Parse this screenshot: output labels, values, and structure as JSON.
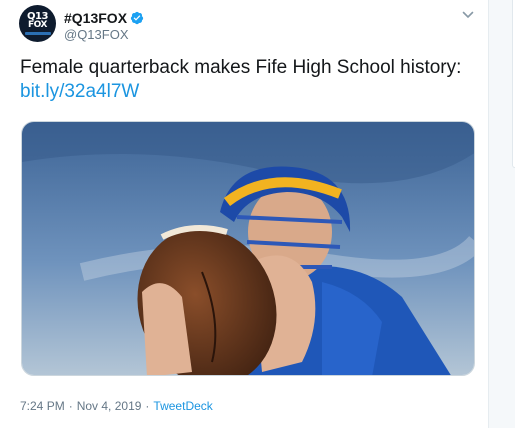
{
  "account": {
    "avatar_line1": "Q13",
    "avatar_line2": "FOX",
    "display_name": "#Q13FOX",
    "handle": "@Q13FOX"
  },
  "tweet": {
    "text": "Female quarterback makes Fife High School history:",
    "link": "bit.ly/32a4l7W",
    "time": "7:24 PM",
    "separator": "·",
    "date": "Nov 4, 2019",
    "separator2": "·",
    "source": "TweetDeck"
  },
  "colors": {
    "link": "#1b95e0",
    "verified": "#1da1f2",
    "meta": "#657786"
  },
  "icons": {
    "verified": "verified-badge-icon",
    "caret": "chevron-down-icon"
  }
}
